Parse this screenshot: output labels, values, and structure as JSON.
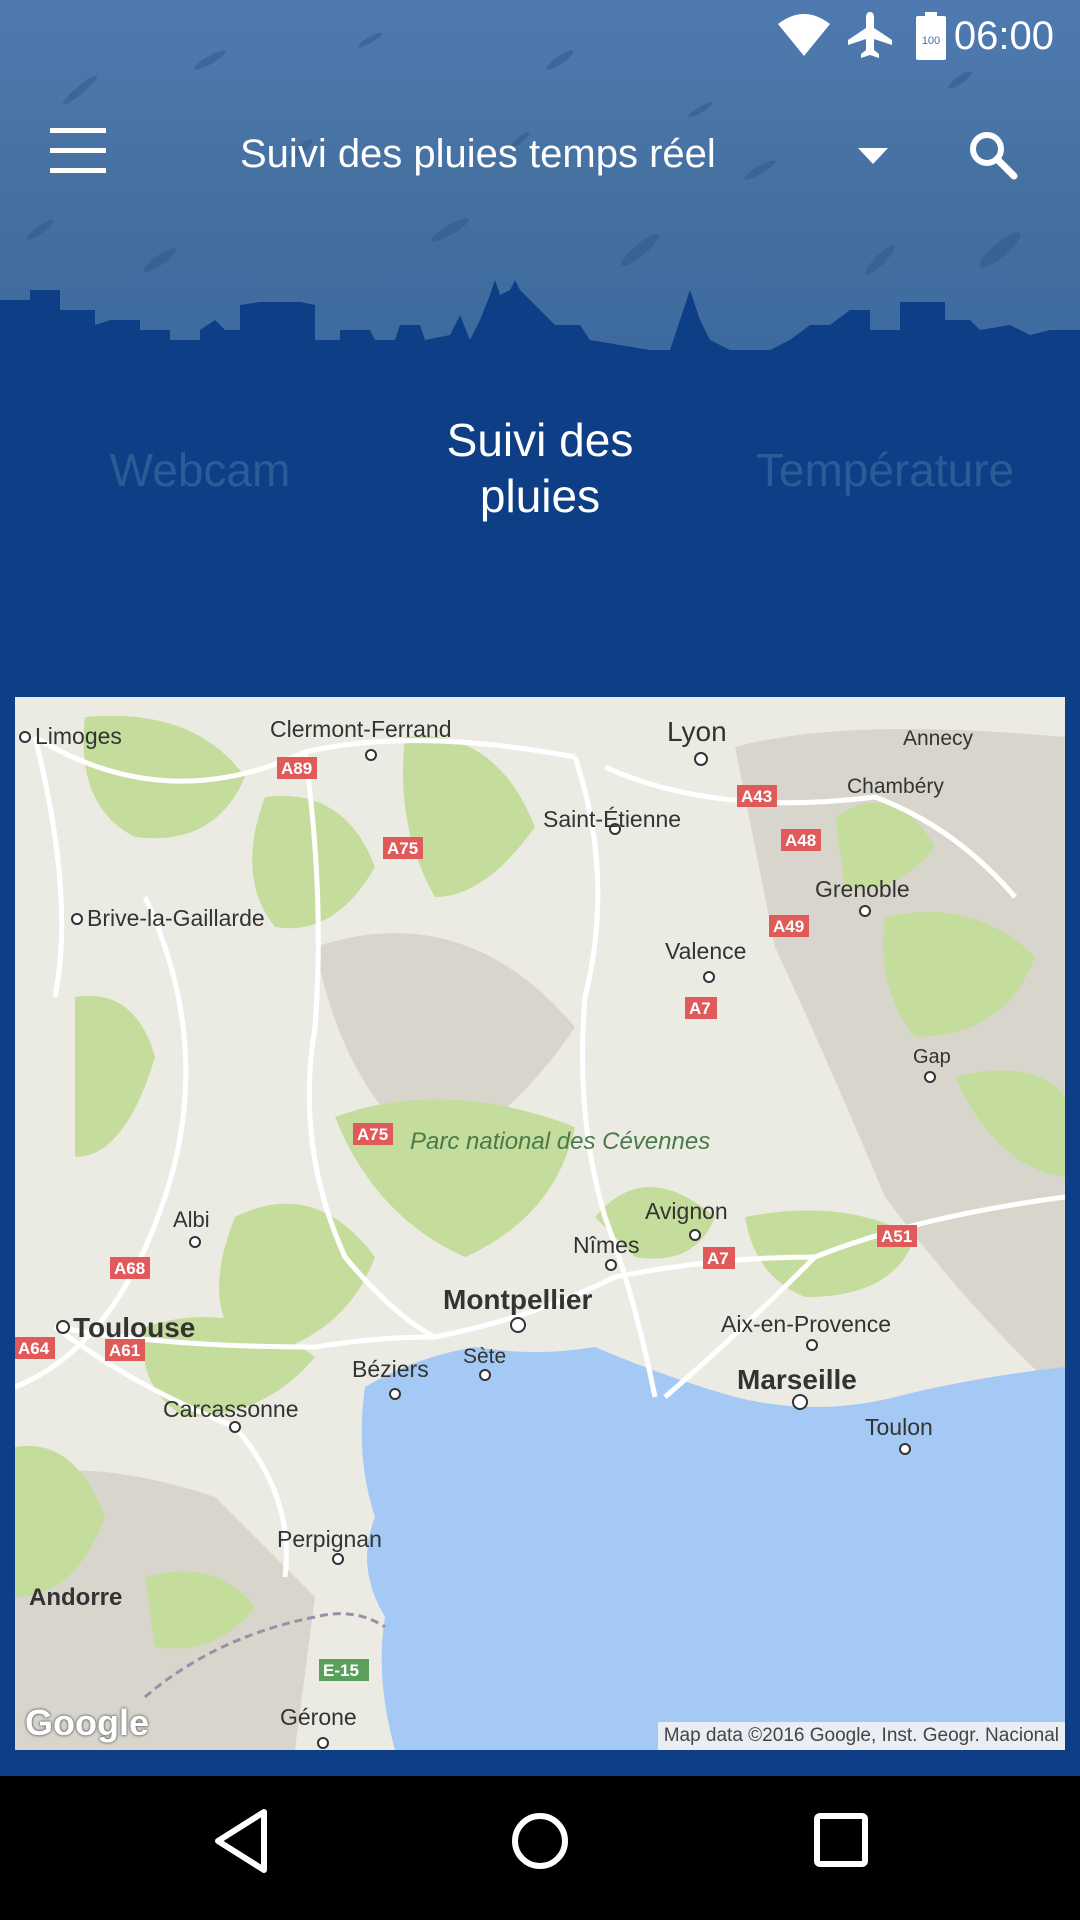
{
  "status_bar": {
    "time": "06:00",
    "battery_level": "100",
    "icons": [
      "wifi-icon",
      "airplane-mode-icon",
      "battery-icon"
    ]
  },
  "toolbar": {
    "title": "Suivi des pluies temps réel",
    "icons": [
      "menu-icon",
      "dropdown-arrow-icon",
      "search-icon"
    ]
  },
  "tabs": [
    {
      "label": "Webcam",
      "selected": false
    },
    {
      "label": "Suivi des pluies",
      "label_lines": [
        "Suivi des",
        "pluies"
      ],
      "selected": true
    },
    {
      "label": "Température",
      "selected": false
    }
  ],
  "map": {
    "cities": [
      "Limoges",
      "Clermont-Ferrand",
      "Lyon",
      "Annecy",
      "Chambéry",
      "Saint-Étienne",
      "Grenoble",
      "Brive-la-Gaillarde",
      "Valence",
      "Gap",
      "Parc national des Cévennes",
      "Albi",
      "Avignon",
      "Nîmes",
      "Montpellier",
      "Toulouse",
      "Aix-en-Provence",
      "Béziers",
      "Sète",
      "Marseille",
      "Toulon",
      "Carcassonne",
      "Perpignan",
      "Andorre",
      "Gérone"
    ],
    "roads": [
      "A89",
      "A43",
      "A75",
      "A48",
      "A49",
      "A7",
      "A75",
      "A68",
      "A7",
      "A51",
      "A64",
      "A61",
      "E-15"
    ],
    "attribution": "Map data ©2016 Google, Inst. Geogr. Nacional",
    "logo": "Google"
  },
  "nav_bar": {
    "buttons": [
      "back-icon",
      "home-icon",
      "recents-icon"
    ]
  },
  "colors": {
    "header_blue": "#4e7ab0",
    "dark_blue": "#0e3e85",
    "sea": "#a5c9f5",
    "land": "#ecebe3",
    "park_green": "#c5dd9c"
  }
}
